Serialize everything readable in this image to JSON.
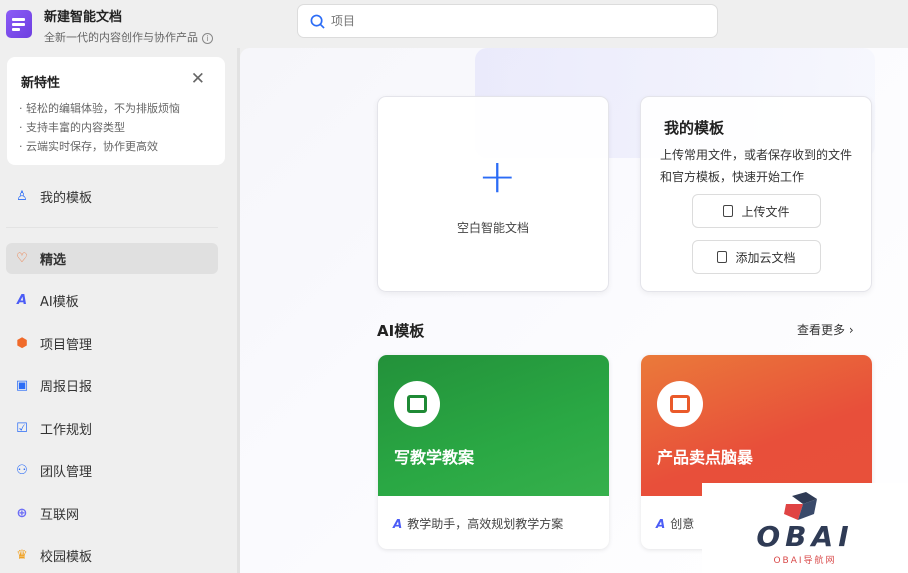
{
  "app": {
    "title": "新建智能文档",
    "subtitle": "全新一代的内容创作与协作产品"
  },
  "feature": {
    "title": "新特性",
    "items": [
      "· 轻松的编辑体验，不为排版烦恼",
      "· 支持丰富的内容类型",
      "· 云端实时保存，协作更高效"
    ]
  },
  "sidebar": {
    "items": [
      {
        "label": "我的模板",
        "icon": "user-icon",
        "color": "#2b6cf6"
      },
      {
        "label": "精选",
        "icon": "diamond-icon",
        "color": "#f06a2a"
      },
      {
        "label": "AI模板",
        "icon": "ai-icon",
        "color": "#4b5cf6"
      },
      {
        "label": "项目管理",
        "icon": "cube-icon",
        "color": "#f06a2a"
      },
      {
        "label": "周报日报",
        "icon": "calendar-icon",
        "color": "#2b6cf6"
      },
      {
        "label": "工作规划",
        "icon": "clipboard-icon",
        "color": "#2b6cf6"
      },
      {
        "label": "团队管理",
        "icon": "team-icon",
        "color": "#2b6cf6"
      },
      {
        "label": "互联网",
        "icon": "globe-icon",
        "color": "#6b6cf6"
      },
      {
        "label": "校园模板",
        "icon": "graduation-cap-icon",
        "color": "#f0a020"
      }
    ]
  },
  "search": {
    "placeholder": "项目"
  },
  "blank": {
    "label": "空白智能文档"
  },
  "my_templates": {
    "title": "我的模板",
    "desc": "上传常用文件，或者保存收到的文件和官方模板，快速开始工作",
    "upload": "上传文件",
    "add_cloud": "添加云文档"
  },
  "ai_section": {
    "title": "AI模板",
    "more": "查看更多"
  },
  "templates": [
    {
      "title": "写教学教案",
      "desc": "教学助手，高效规划教学方案",
      "color": "#2aa844"
    },
    {
      "title": "产品卖点脑暴",
      "desc": "创意",
      "color": "#ea5a3a"
    }
  ],
  "watermark": {
    "logo": "OBAI",
    "sub": "OBAI导航网"
  }
}
